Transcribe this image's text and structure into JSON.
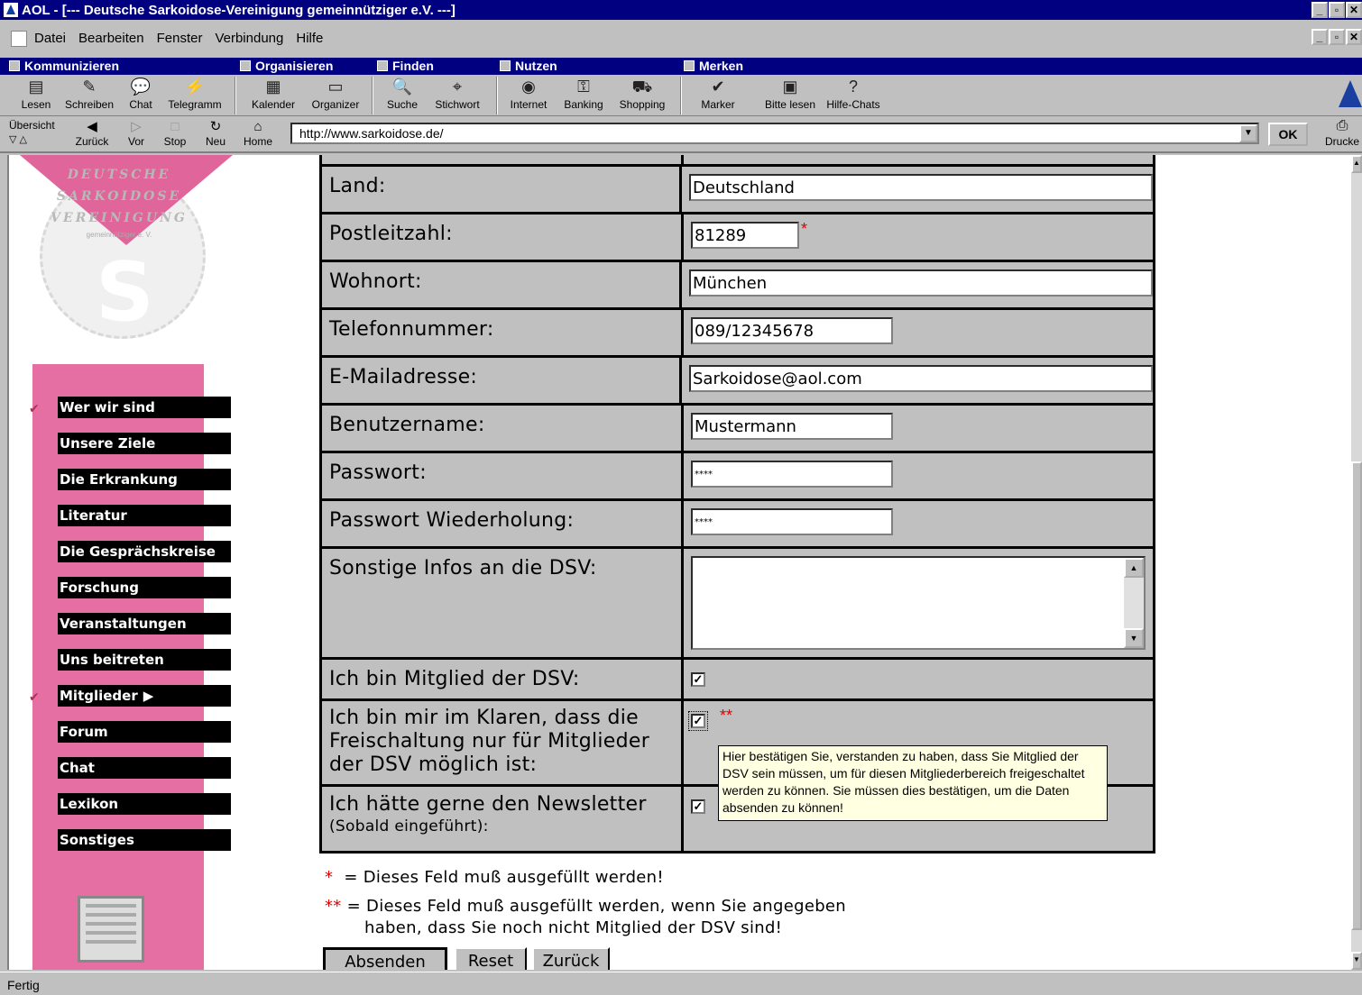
{
  "window": {
    "title": "AOL - [--- Deutsche Sarkoidose-Vereinigung gemeinnütziger e.V. ---]",
    "min": "_",
    "max": "▫",
    "close": "✕"
  },
  "menu": [
    "Datei",
    "Bearbeiten",
    "Fenster",
    "Verbindung",
    "Hilfe"
  ],
  "groups": [
    "Kommunizieren",
    "Organisieren",
    "Finden",
    "Nutzen",
    "Merken"
  ],
  "toolbar": [
    {
      "label": "Lesen",
      "icon": "▤"
    },
    {
      "label": "Schreiben",
      "icon": "✎"
    },
    {
      "label": "Chat",
      "icon": "💬"
    },
    {
      "label": "Telegramm",
      "icon": "⚡"
    },
    {
      "label": "Kalender",
      "icon": "▦"
    },
    {
      "label": "Organizer",
      "icon": "▭"
    },
    {
      "label": "Suche",
      "icon": "🔍"
    },
    {
      "label": "Stichwort",
      "icon": "⌖"
    },
    {
      "label": "Internet",
      "icon": "◉"
    },
    {
      "label": "Banking",
      "icon": "⚿"
    },
    {
      "label": "Shopping",
      "icon": "⛟"
    },
    {
      "label": "Marker",
      "icon": "✔"
    },
    {
      "label": "Bitte lesen",
      "icon": "▣"
    },
    {
      "label": "Hilfe-Chats",
      "icon": "?"
    }
  ],
  "nav": {
    "overview": "Übersicht",
    "back": "Zurück",
    "forward": "Vor",
    "stop": "Stop",
    "reload": "Neu",
    "home": "Home",
    "url": "http://www.sarkoidose.de/",
    "ok": "OK",
    "print": "Drucke"
  },
  "logo": {
    "line1": "DEUTSCHE",
    "line2": "SARKOIDOSE",
    "line3": "VEREINIGUNG",
    "sub": "gemeinnütziger e. V.",
    "letter": "S"
  },
  "sidebar": [
    {
      "label": "Wer wir sind",
      "checked": true
    },
    {
      "label": "Unsere Ziele",
      "checked": false
    },
    {
      "label": "Die Erkrankung",
      "checked": false
    },
    {
      "label": "Literatur",
      "checked": false
    },
    {
      "label": "Die Gesprächskreise",
      "checked": false
    },
    {
      "label": "Forschung",
      "checked": false
    },
    {
      "label": "Veranstaltungen",
      "checked": false
    },
    {
      "label": "Uns beitreten",
      "checked": false
    },
    {
      "label": "Mitglieder",
      "checked": true
    },
    {
      "label": "Forum",
      "checked": false
    },
    {
      "label": "Chat",
      "checked": false
    },
    {
      "label": "Lexikon",
      "checked": false
    },
    {
      "label": "Sonstiges",
      "checked": false
    }
  ],
  "form": {
    "land_label": "Land:",
    "land_value": "Deutschland",
    "plz_label": "Postleitzahl:",
    "plz_value": "81289",
    "ort_label": "Wohnort:",
    "ort_value": "München",
    "tel_label": "Telefonnummer:",
    "tel_value": "089/12345678",
    "mail_label": "E-Mailadresse:",
    "mail_value": "Sarkoidose@aol.com",
    "user_label": "Benutzername:",
    "user_value": "Mustermann",
    "pw_label": "Passwort:",
    "pw_value": "****",
    "pw2_label": "Passwort Wiederholung:",
    "pw2_value": "****",
    "info_label": "Sonstige Infos an die DSV:",
    "member_label": "Ich bin Mitglied der DSV:",
    "aware_label": "Ich bin mir im Klaren, dass die Freischaltung nur für Mitglieder der DSV möglich ist:",
    "news_label": "Ich hätte gerne den Newsletter",
    "news_sub": "(Sobald eingeführt):",
    "star": "*",
    "dstar": "**",
    "check": "✓"
  },
  "tooltip": "Hier bestätigen Sie, verstanden zu haben, dass Sie Mitglied der DSV sein müssen, um für diesen Mitgliederbereich freigeschaltet werden zu können. Sie müssen dies bestätigen, um die Daten absenden zu können!",
  "notes": {
    "n1": "= Dieses Feld muß ausgefüllt werden!",
    "n2a": "= Dieses Feld muß ausgefüllt werden, wenn Sie angegeben",
    "n2b": "haben, dass Sie noch nicht Mitglied der DSV sind!"
  },
  "buttons": {
    "submit": "Absenden",
    "reset": "Reset",
    "back": "Zurück"
  },
  "status": "Fertig"
}
